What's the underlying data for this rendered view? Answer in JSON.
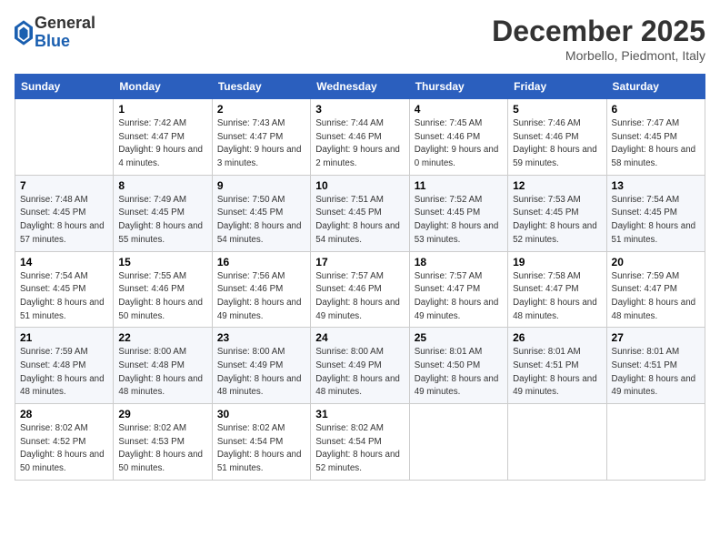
{
  "header": {
    "logo": {
      "general": "General",
      "blue": "Blue"
    },
    "title": "December 2025",
    "location": "Morbello, Piedmont, Italy"
  },
  "calendar": {
    "weekdays": [
      "Sunday",
      "Monday",
      "Tuesday",
      "Wednesday",
      "Thursday",
      "Friday",
      "Saturday"
    ],
    "weeks": [
      [
        {
          "day": "",
          "sunrise": "",
          "sunset": "",
          "daylight": ""
        },
        {
          "day": "1",
          "sunrise": "Sunrise: 7:42 AM",
          "sunset": "Sunset: 4:47 PM",
          "daylight": "Daylight: 9 hours and 4 minutes."
        },
        {
          "day": "2",
          "sunrise": "Sunrise: 7:43 AM",
          "sunset": "Sunset: 4:47 PM",
          "daylight": "Daylight: 9 hours and 3 minutes."
        },
        {
          "day": "3",
          "sunrise": "Sunrise: 7:44 AM",
          "sunset": "Sunset: 4:46 PM",
          "daylight": "Daylight: 9 hours and 2 minutes."
        },
        {
          "day": "4",
          "sunrise": "Sunrise: 7:45 AM",
          "sunset": "Sunset: 4:46 PM",
          "daylight": "Daylight: 9 hours and 0 minutes."
        },
        {
          "day": "5",
          "sunrise": "Sunrise: 7:46 AM",
          "sunset": "Sunset: 4:46 PM",
          "daylight": "Daylight: 8 hours and 59 minutes."
        },
        {
          "day": "6",
          "sunrise": "Sunrise: 7:47 AM",
          "sunset": "Sunset: 4:45 PM",
          "daylight": "Daylight: 8 hours and 58 minutes."
        }
      ],
      [
        {
          "day": "7",
          "sunrise": "Sunrise: 7:48 AM",
          "sunset": "Sunset: 4:45 PM",
          "daylight": "Daylight: 8 hours and 57 minutes."
        },
        {
          "day": "8",
          "sunrise": "Sunrise: 7:49 AM",
          "sunset": "Sunset: 4:45 PM",
          "daylight": "Daylight: 8 hours and 55 minutes."
        },
        {
          "day": "9",
          "sunrise": "Sunrise: 7:50 AM",
          "sunset": "Sunset: 4:45 PM",
          "daylight": "Daylight: 8 hours and 54 minutes."
        },
        {
          "day": "10",
          "sunrise": "Sunrise: 7:51 AM",
          "sunset": "Sunset: 4:45 PM",
          "daylight": "Daylight: 8 hours and 54 minutes."
        },
        {
          "day": "11",
          "sunrise": "Sunrise: 7:52 AM",
          "sunset": "Sunset: 4:45 PM",
          "daylight": "Daylight: 8 hours and 53 minutes."
        },
        {
          "day": "12",
          "sunrise": "Sunrise: 7:53 AM",
          "sunset": "Sunset: 4:45 PM",
          "daylight": "Daylight: 8 hours and 52 minutes."
        },
        {
          "day": "13",
          "sunrise": "Sunrise: 7:54 AM",
          "sunset": "Sunset: 4:45 PM",
          "daylight": "Daylight: 8 hours and 51 minutes."
        }
      ],
      [
        {
          "day": "14",
          "sunrise": "Sunrise: 7:54 AM",
          "sunset": "Sunset: 4:45 PM",
          "daylight": "Daylight: 8 hours and 51 minutes."
        },
        {
          "day": "15",
          "sunrise": "Sunrise: 7:55 AM",
          "sunset": "Sunset: 4:46 PM",
          "daylight": "Daylight: 8 hours and 50 minutes."
        },
        {
          "day": "16",
          "sunrise": "Sunrise: 7:56 AM",
          "sunset": "Sunset: 4:46 PM",
          "daylight": "Daylight: 8 hours and 49 minutes."
        },
        {
          "day": "17",
          "sunrise": "Sunrise: 7:57 AM",
          "sunset": "Sunset: 4:46 PM",
          "daylight": "Daylight: 8 hours and 49 minutes."
        },
        {
          "day": "18",
          "sunrise": "Sunrise: 7:57 AM",
          "sunset": "Sunset: 4:47 PM",
          "daylight": "Daylight: 8 hours and 49 minutes."
        },
        {
          "day": "19",
          "sunrise": "Sunrise: 7:58 AM",
          "sunset": "Sunset: 4:47 PM",
          "daylight": "Daylight: 8 hours and 48 minutes."
        },
        {
          "day": "20",
          "sunrise": "Sunrise: 7:59 AM",
          "sunset": "Sunset: 4:47 PM",
          "daylight": "Daylight: 8 hours and 48 minutes."
        }
      ],
      [
        {
          "day": "21",
          "sunrise": "Sunrise: 7:59 AM",
          "sunset": "Sunset: 4:48 PM",
          "daylight": "Daylight: 8 hours and 48 minutes."
        },
        {
          "day": "22",
          "sunrise": "Sunrise: 8:00 AM",
          "sunset": "Sunset: 4:48 PM",
          "daylight": "Daylight: 8 hours and 48 minutes."
        },
        {
          "day": "23",
          "sunrise": "Sunrise: 8:00 AM",
          "sunset": "Sunset: 4:49 PM",
          "daylight": "Daylight: 8 hours and 48 minutes."
        },
        {
          "day": "24",
          "sunrise": "Sunrise: 8:00 AM",
          "sunset": "Sunset: 4:49 PM",
          "daylight": "Daylight: 8 hours and 48 minutes."
        },
        {
          "day": "25",
          "sunrise": "Sunrise: 8:01 AM",
          "sunset": "Sunset: 4:50 PM",
          "daylight": "Daylight: 8 hours and 49 minutes."
        },
        {
          "day": "26",
          "sunrise": "Sunrise: 8:01 AM",
          "sunset": "Sunset: 4:51 PM",
          "daylight": "Daylight: 8 hours and 49 minutes."
        },
        {
          "day": "27",
          "sunrise": "Sunrise: 8:01 AM",
          "sunset": "Sunset: 4:51 PM",
          "daylight": "Daylight: 8 hours and 49 minutes."
        }
      ],
      [
        {
          "day": "28",
          "sunrise": "Sunrise: 8:02 AM",
          "sunset": "Sunset: 4:52 PM",
          "daylight": "Daylight: 8 hours and 50 minutes."
        },
        {
          "day": "29",
          "sunrise": "Sunrise: 8:02 AM",
          "sunset": "Sunset: 4:53 PM",
          "daylight": "Daylight: 8 hours and 50 minutes."
        },
        {
          "day": "30",
          "sunrise": "Sunrise: 8:02 AM",
          "sunset": "Sunset: 4:54 PM",
          "daylight": "Daylight: 8 hours and 51 minutes."
        },
        {
          "day": "31",
          "sunrise": "Sunrise: 8:02 AM",
          "sunset": "Sunset: 4:54 PM",
          "daylight": "Daylight: 8 hours and 52 minutes."
        },
        {
          "day": "",
          "sunrise": "",
          "sunset": "",
          "daylight": ""
        },
        {
          "day": "",
          "sunrise": "",
          "sunset": "",
          "daylight": ""
        },
        {
          "day": "",
          "sunrise": "",
          "sunset": "",
          "daylight": ""
        }
      ]
    ]
  }
}
